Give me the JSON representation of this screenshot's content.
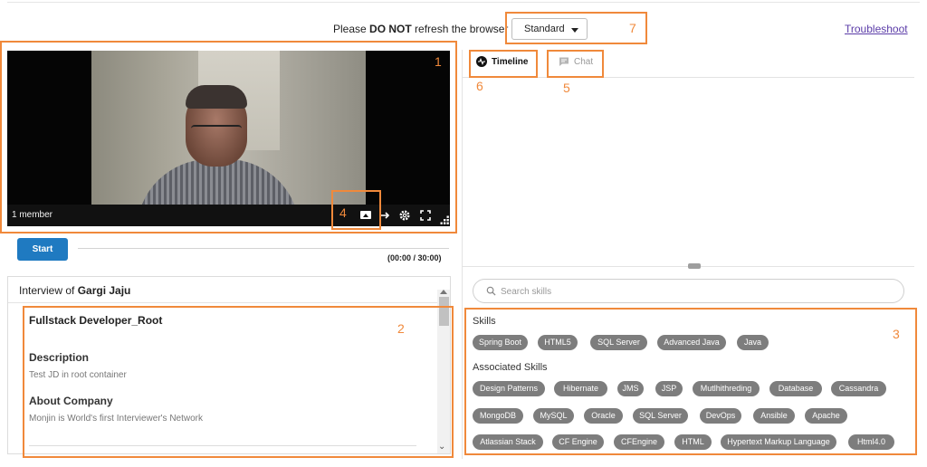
{
  "header": {
    "notice_prefix": "Please ",
    "notice_emphasis": "DO NOT",
    "notice_suffix": " refresh the browser",
    "quality_selected": "Standard",
    "troubleshoot_label": "Troubleshoot"
  },
  "callouts": [
    "1",
    "2",
    "3",
    "4",
    "5",
    "6",
    "7"
  ],
  "video": {
    "member_count": "1 member",
    "controls": [
      "screen-share-icon",
      "switch-icon",
      "settings-icon",
      "fullscreen-icon",
      "resize-grip-icon"
    ]
  },
  "session": {
    "start_label": "Start",
    "timer": "(00:00 / 30:00)"
  },
  "interview": {
    "header_prefix": "Interview of ",
    "candidate_name": "Gargi Jaju",
    "job_title": "Fullstack Developer_Root",
    "description_heading": "Description",
    "description_text": "Test JD in root container",
    "about_heading": "About Company",
    "about_text": "Monjin is World's first Interviewer's Network"
  },
  "tabs": {
    "timeline_label": "Timeline",
    "chat_label": "Chat",
    "active": "Timeline"
  },
  "skills": {
    "search_placeholder": "Search skills",
    "skills_heading": "Skills",
    "associated_heading": "Associated Skills",
    "primary": [
      "Spring Boot",
      "HTML5",
      "SQL Server",
      "Advanced Java",
      "Java"
    ],
    "associated_row1": [
      "Design Patterns",
      "Hibernate",
      "JMS",
      "JSP",
      "Mutlhithreding",
      "Database",
      "Cassandra"
    ],
    "associated_row2": [
      "MongoDB",
      "MySQL",
      "Oracle",
      "SQL Server",
      "DevOps",
      "Ansible",
      "Apache"
    ],
    "associated_row3": [
      "Atlassian Stack",
      "CF Engine",
      "CFEngine",
      "HTML",
      "Hypertext Markup Language",
      "Html4.0"
    ]
  },
  "colors": {
    "callout": "#f0893b",
    "primary_button": "#1f7ac1",
    "chip": "#7d7d7d",
    "link": "#5b3ca8"
  }
}
